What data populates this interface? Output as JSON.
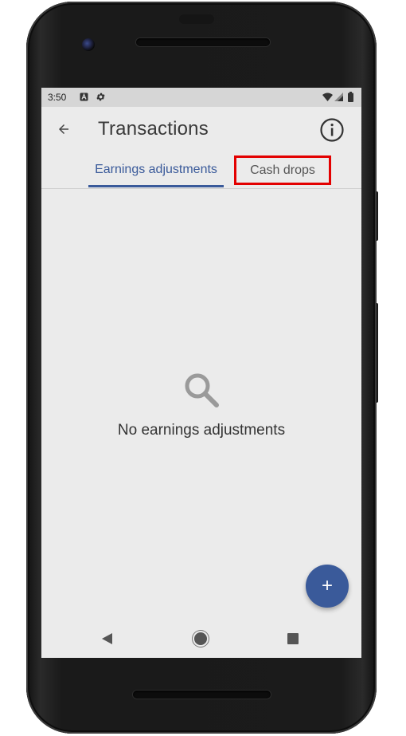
{
  "status_bar": {
    "time": "3:50",
    "icons": [
      "notification-a-icon",
      "settings-gear-icon",
      "wifi-icon",
      "signal-icon",
      "battery-icon"
    ]
  },
  "app_bar": {
    "title": "Transactions",
    "back_icon": "arrow-back-icon",
    "info_icon": "info-icon"
  },
  "tabs": [
    {
      "label": "Earnings adjustments",
      "selected": true
    },
    {
      "label": "Cash drops",
      "selected": false,
      "highlighted": true
    }
  ],
  "empty_state": {
    "icon": "search-icon",
    "message": "No earnings adjustments"
  },
  "fab": {
    "label": "+",
    "icon": "add-icon"
  },
  "nav_bar": {
    "icons": [
      "nav-back-icon",
      "nav-home-icon",
      "nav-recents-icon"
    ]
  },
  "colors": {
    "accent": "#3a5a9a",
    "highlight_box": "#e30000",
    "screen_background": "#ebebeb",
    "status_bar": "#d6d6d6"
  }
}
